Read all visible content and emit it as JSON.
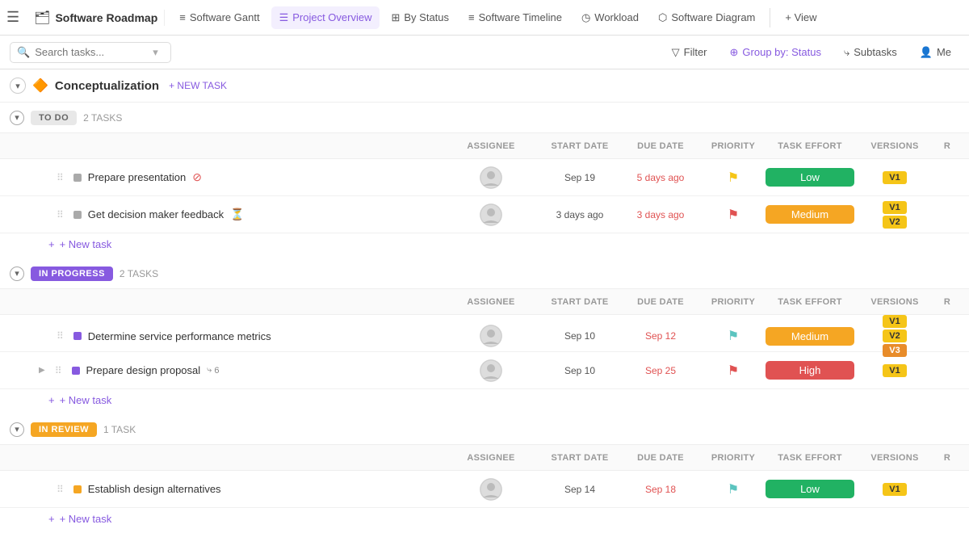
{
  "nav": {
    "title": "Software Roadmap",
    "tabs": [
      {
        "id": "gantt",
        "label": "Software Gantt",
        "icon": "≡",
        "active": false
      },
      {
        "id": "overview",
        "label": "Project Overview",
        "icon": "☰",
        "active": true
      },
      {
        "id": "status",
        "label": "By Status",
        "icon": "⊞",
        "active": false
      },
      {
        "id": "timeline",
        "label": "Software Timeline",
        "icon": "≡",
        "active": false
      },
      {
        "id": "workload",
        "label": "Workload",
        "icon": "◷",
        "active": false
      },
      {
        "id": "diagram",
        "label": "Software Diagram",
        "icon": "⬡",
        "active": false
      }
    ],
    "view_btn": "+ View"
  },
  "toolbar": {
    "search_placeholder": "Search tasks...",
    "filter_label": "Filter",
    "group_by_label": "Group by: Status",
    "subtasks_label": "Subtasks",
    "me_label": "Me"
  },
  "section": {
    "title": "Conceptualization",
    "new_task_label": "+ NEW TASK"
  },
  "groups": [
    {
      "id": "todo",
      "badge": "TO DO",
      "badge_class": "badge-todo",
      "task_count": "2 TASKS",
      "columns": {
        "assignee": "ASSIGNEE",
        "start_date": "START DATE",
        "due_date": "DUE DATE",
        "priority": "PRIORITY",
        "task_effort": "TASK EFFORT",
        "versions": "VERSIONS",
        "r": "R"
      },
      "tasks": [
        {
          "name": "Prepare presentation",
          "has_blocked": true,
          "blocked_icon": "⊘",
          "assignee": "👤",
          "start_date": "Sep 19",
          "due_date": "5 days ago",
          "due_overdue": true,
          "priority_flag": "🚩",
          "priority_color": "yellow",
          "effort": "Low",
          "effort_class": "effort-low",
          "versions": [
            "V1"
          ],
          "version_classes": [
            ""
          ]
        },
        {
          "name": "Get decision maker feedback",
          "has_pending": true,
          "pending_icon": "⏳",
          "assignee": "👤",
          "start_date": "3 days ago",
          "due_date": "3 days ago",
          "due_overdue": true,
          "priority_flag": "🚩",
          "priority_color": "red",
          "effort": "Medium",
          "effort_class": "effort-medium",
          "versions": [
            "V1",
            "V2"
          ],
          "version_classes": [
            "",
            "v2"
          ]
        }
      ]
    },
    {
      "id": "inprogress",
      "badge": "IN PROGRESS",
      "badge_class": "badge-inprogress",
      "task_count": "2 TASKS",
      "columns": {
        "assignee": "ASSIGNEE",
        "start_date": "START DATE",
        "due_date": "DUE DATE",
        "priority": "PRIORITY",
        "task_effort": "TASK EFFORT",
        "versions": "VERSIONS",
        "r": "R"
      },
      "tasks": [
        {
          "name": "Determine service performance metrics",
          "assignee": "👤",
          "start_date": "Sep 10",
          "due_date": "Sep 12",
          "due_overdue": true,
          "priority_flag": "⚑",
          "priority_color": "teal",
          "effort": "Medium",
          "effort_class": "effort-medium",
          "versions": [
            "V1",
            "V2",
            "V3"
          ],
          "version_classes": [
            "",
            "v2",
            "v3"
          ]
        },
        {
          "name": "Prepare design proposal",
          "has_subtasks": true,
          "subtask_count": "6",
          "has_expand": true,
          "assignee": "👤",
          "start_date": "Sep 10",
          "due_date": "Sep 25",
          "due_overdue": true,
          "priority_flag": "🚩",
          "priority_color": "red",
          "effort": "High",
          "effort_class": "effort-high",
          "versions": [
            "V1"
          ],
          "version_classes": [
            ""
          ]
        }
      ]
    },
    {
      "id": "inreview",
      "badge": "IN REVIEW",
      "badge_class": "badge-inreview",
      "task_count": "1 TASK",
      "columns": {
        "assignee": "ASSIGNEE",
        "start_date": "START DATE",
        "due_date": "DUE DATE",
        "priority": "PRIORITY",
        "task_effort": "TASK EFFORT",
        "versions": "VERSIONS",
        "r": "R"
      },
      "tasks": [
        {
          "name": "Establish design alternatives",
          "assignee": "👤",
          "start_date": "Sep 14",
          "due_date": "Sep 18",
          "due_overdue": true,
          "priority_flag": "⚑",
          "priority_color": "teal",
          "effort": "Low",
          "effort_class": "effort-low",
          "versions": [
            "V1"
          ],
          "version_classes": [
            ""
          ]
        }
      ]
    }
  ],
  "new_task_label": "+ New task"
}
